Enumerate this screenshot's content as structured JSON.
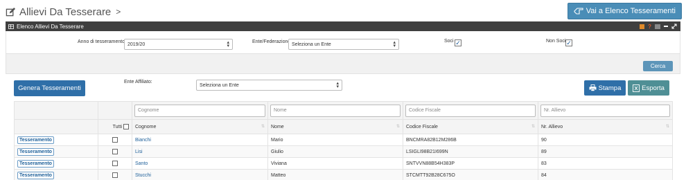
{
  "header": {
    "title": "Allievi Da Tesserare",
    "chevron": ">",
    "goto_label": "Vai a Elenco Tesseramenti"
  },
  "panel": {
    "title": "Elenco Allievi Da Tesserare",
    "help": "?"
  },
  "filters": {
    "anno_label": "Anno di tesseramento",
    "anno_value": "2019/20",
    "ente_label": "Ente/Federazione",
    "ente_value": "Seleziona un Ente",
    "soci_label": "Soci",
    "soci_checked": true,
    "non_soci_label": "Non Soci",
    "non_soci_checked": true,
    "search_label": "Cerca"
  },
  "actions": {
    "genera_label": "Genera Tesseramenti",
    "ente_affiliato_label": "Ente Affiliato:",
    "ente_affiliato_value": "Seleziona un Ente",
    "stampa_label": "Stampa",
    "esporta_label": "Esporta"
  },
  "table": {
    "filter_placeholders": {
      "cognome": "Cognome",
      "nome": "Nome",
      "codice_fiscale": "Codice Fiscale",
      "nr_allievo": "Nr. Allievo"
    },
    "headers": {
      "tutti": "Tutti",
      "cognome": "Cognome",
      "nome": "Nome",
      "codice_fiscale": "Codice Fiscale",
      "nr_allievo": "Nr. Allievo"
    },
    "row_button_label": "Tesseramento",
    "rows": [
      {
        "cognome": "Bianchi",
        "nome": "Mario",
        "codice_fiscale": "BNCMRA82B12M286B",
        "nr_allievo": "90"
      },
      {
        "cognome": "Lisi",
        "nome": "Giulio",
        "codice_fiscale": "LSIGLI98B21I699N",
        "nr_allievo": "89"
      },
      {
        "cognome": "Santo",
        "nome": "Viviana",
        "codice_fiscale": "SNTVVN88B54H383P",
        "nr_allievo": "83"
      },
      {
        "cognome": "Stucchi",
        "nome": "Matteo",
        "codice_fiscale": "STCMTT92B28C675O",
        "nr_allievo": "84"
      }
    ]
  },
  "colors": {
    "primary": "#2f6fa8",
    "goto": "#4a8db7",
    "esporta": "#4f8f95",
    "panel_bar": "#3f3f3f"
  }
}
